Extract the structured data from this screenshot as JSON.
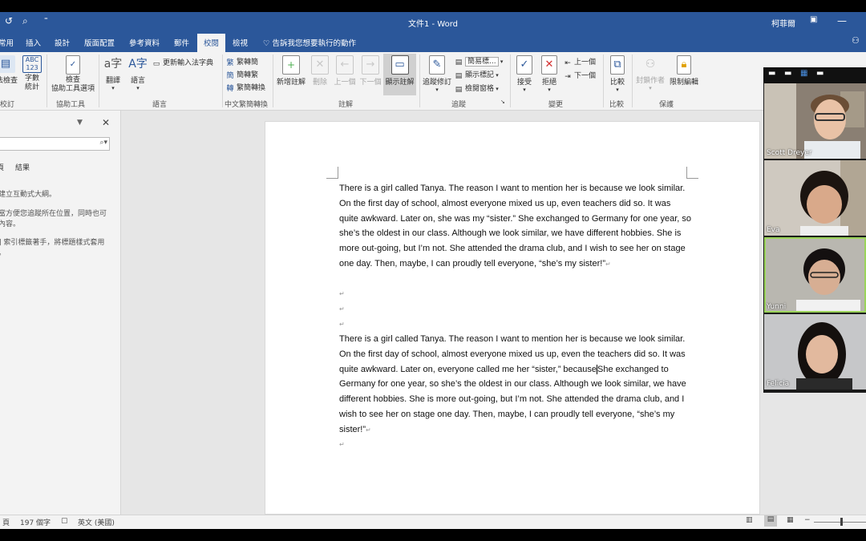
{
  "window": {
    "title": "文件1 - Word",
    "user": "柯菲爾"
  },
  "quick_access": {
    "undo_icon": "undo-icon",
    "preview_icon": "print-preview-icon",
    "customize_icon": "customize-icon"
  },
  "tabs": {
    "items": [
      "常用",
      "插入",
      "設計",
      "版面配置",
      "參考資料",
      "郵件",
      "校閱",
      "檢視"
    ],
    "active": "校閱",
    "tell_me": "告訴我您想要執行的動作"
  },
  "ribbon": {
    "proofing": {
      "spell": "拼字及文法檢查",
      "abc": "ABC\n123",
      "word_count": "字數統計",
      "label": "校訂"
    },
    "accessibility": {
      "check": "檢查\n協助工具選項",
      "label": "協助工具"
    },
    "language": {
      "translate": "翻譯",
      "language": "語言",
      "update_ime": "更新輸入法字典",
      "label": "語言"
    },
    "chinese": {
      "t2s": "繁轉簡",
      "s2t": "簡轉繁",
      "convert": "繁簡轉換",
      "label": "中文繁簡轉換"
    },
    "comments": {
      "new": "新增註解",
      "delete": "刪除",
      "prev": "上一個",
      "next": "下一個",
      "show": "顯示註解",
      "label": "註解"
    },
    "tracking": {
      "track": "追蹤修訂",
      "display": "簡易標...",
      "show_markup": "顯示標記",
      "reviewing_pane": "檢閱窗格",
      "label": "追蹤"
    },
    "changes": {
      "accept": "接受",
      "reject": "拒絕",
      "prev": "上一個",
      "next": "下一個",
      "label": "變更"
    },
    "compare": {
      "compare": "比較",
      "label": "比較"
    },
    "protect": {
      "block": "封鎖作者",
      "restrict": "限制編輯",
      "label": "保護"
    }
  },
  "nav_pane": {
    "search_placeholder": "",
    "tab_results": "結果",
    "tab_left": "頁",
    "msg1": "建立互動式大綱。",
    "msg2": "當方便您追蹤所在位置，同時也可",
    "msg3": "內容。",
    "msg4": "] 索引標籤著手，將標題樣式套用",
    "msg5": "。"
  },
  "document": {
    "paragraph1": "There is a girl called Tanya. The reason I want to mention her is because we look similar. On the first day of school, almost everyone mixed us up, even teachers did so. It was quite awkward. Later on, she was my “sister.” She exchanged to Germany for one year, so she’s the oldest in our class. Although we look similar, we have different hobbies. She is more out-going, but I’m not. She attended the drama club, and I wish to see her on stage one day. Then, maybe, I can proudly tell everyone, “she’s my sister!”",
    "paragraph2a": "There is a girl called Tanya. The reason I want to mention her is because we look similar. On the first day of school, almost everyone mixed us up, even the teachers did so. It was quite awkward. Later on, everyone called me her “sister,” because",
    "paragraph2b": "She exchanged to Germany for one year, so she’s the oldest in our class. Although we look similar, we have different hobbies. She is more out-going, but I’m not. She attended the drama club, and I wish to see her on stage one day. Then, maybe, I can proudly tell everyone, “she’s my sister!”",
    "para_mark": "↵"
  },
  "statusbar": {
    "page": "頁",
    "word_count": "197 個字",
    "language": "英文 (美國)"
  },
  "zoom": {
    "participants": [
      {
        "name": "Scott Dreyer",
        "bg": "#8a7f73",
        "skin": "#e9c2a6",
        "hair": "#6b4e36"
      },
      {
        "name": "Eva",
        "bg": "#cfc9c0",
        "skin": "#d9a98a",
        "hair": "#1b1410"
      },
      {
        "name": "Yunni",
        "bg": "#b9b7b0",
        "skin": "#d7ae93",
        "hair": "#141010"
      },
      {
        "name": "Felicia",
        "bg": "#c6c7c9",
        "skin": "#e2b99e",
        "hair": "#14100e"
      }
    ],
    "active_speaker": "Yunni",
    "accent": "#9bd45a"
  },
  "colors": {
    "word_blue": "#2b579a",
    "ribbon_bg": "#f3f3f3",
    "workspace": "#e6e6e6"
  }
}
